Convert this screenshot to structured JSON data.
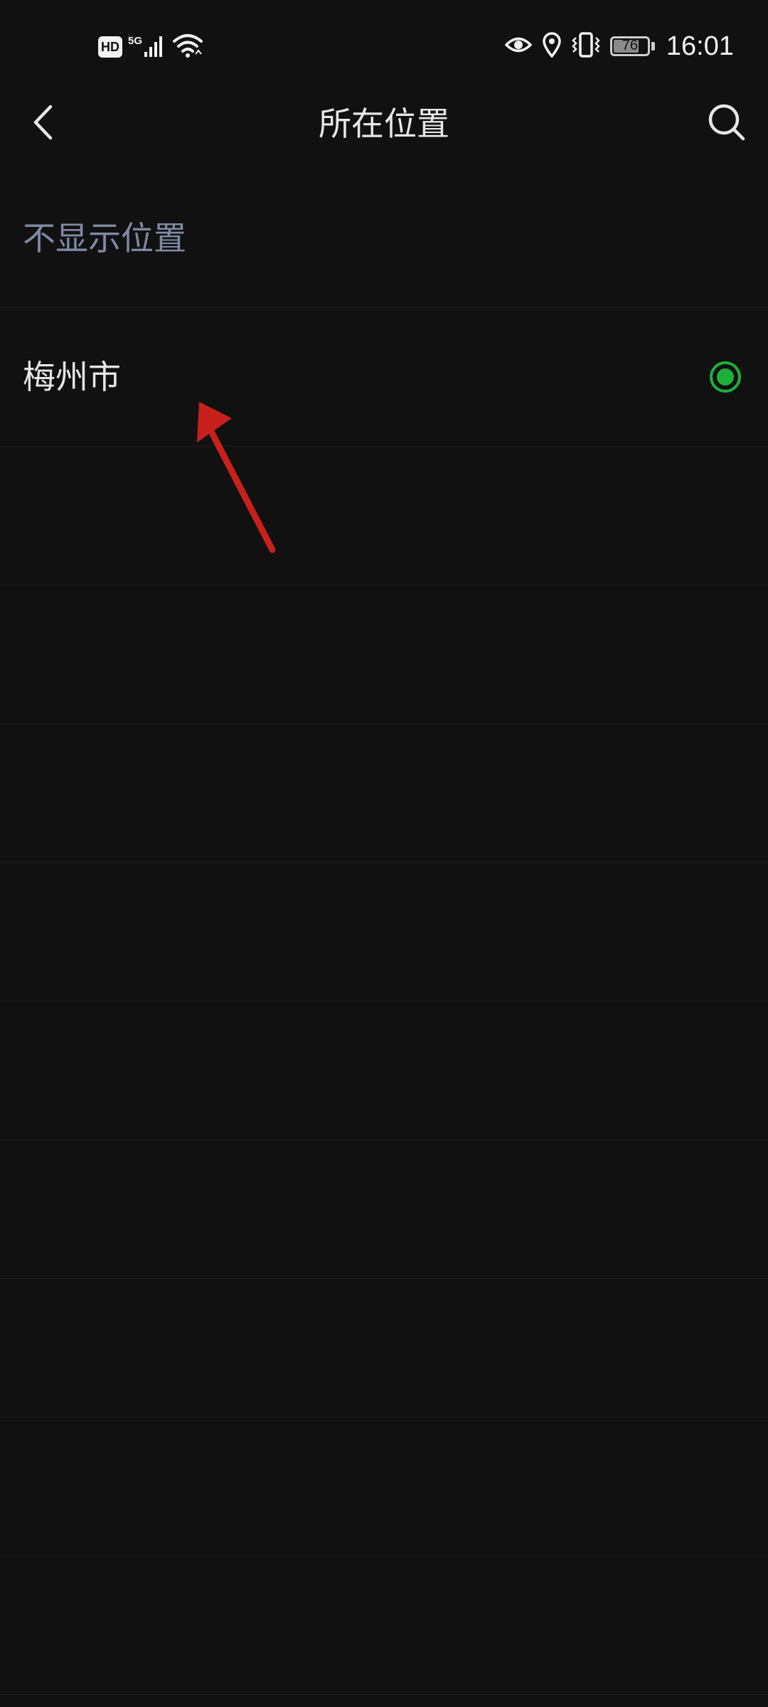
{
  "status_bar": {
    "hd_label": "HD",
    "network_type": "5G",
    "battery_level": "76",
    "battery_fraction": 0.76,
    "time": "16:01",
    "icons": [
      "signal-icon",
      "wifi-icon",
      "eye-icon",
      "location-icon",
      "vibrate-icon",
      "battery-icon"
    ]
  },
  "nav": {
    "title": "所在位置",
    "back_icon": "chevron-left-icon",
    "search_icon": "search-icon"
  },
  "locations": {
    "hide_location_label": "不显示位置",
    "items": [
      {
        "label": "梅州市",
        "selected": true
      }
    ],
    "empty_rows": 9
  },
  "colors": {
    "background": "#111111",
    "muted_text": "#7f8aa3",
    "selected_accent": "#1fb03a",
    "annotation_arrow": "#c8201c"
  }
}
